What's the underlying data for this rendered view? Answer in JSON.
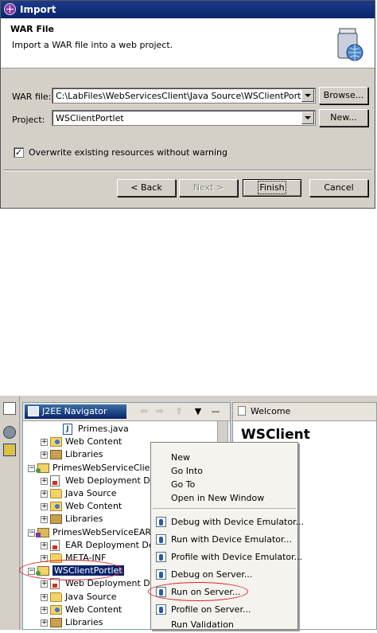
{
  "dialog": {
    "title": "Import",
    "banner_title": "WAR File",
    "banner_description": "Import a WAR file into a web project.",
    "war_file_label": "WAR file:",
    "war_file_value": "C:\\LabFiles\\WebServicesClient\\Java Source\\WSClientPortlet.wa",
    "browse_label": "Browse...",
    "project_label": "Project:",
    "project_value": "WSClientPortlet",
    "new_label": "New...",
    "overwrite_label": "Overwrite existing resources without warning",
    "overwrite_checked": true,
    "back_label": "< Back",
    "next_label": "Next >",
    "finish_label": "Finish",
    "cancel_label": "Cancel"
  },
  "navigator": {
    "tab_title": "J2EE Navigator",
    "welcome_tab": "Welcome",
    "welcome_heading": "WSClient",
    "tree": [
      {
        "label": "Primes.java",
        "icon": "java-file-icon",
        "indent": 3
      },
      {
        "label": "Web Content",
        "icon": "web-content-folder-icon",
        "indent": 2
      },
      {
        "label": "Libraries",
        "icon": "libraries-icon",
        "indent": 2
      },
      {
        "label": "PrimesWebServiceClient",
        "icon": "web-project-icon",
        "indent": 1
      },
      {
        "label": "Web Deployment De",
        "icon": "deployment-descriptor-icon",
        "indent": 2
      },
      {
        "label": "Java Source",
        "icon": "folder-icon",
        "indent": 2
      },
      {
        "label": "Web Content",
        "icon": "web-content-folder-icon",
        "indent": 2
      },
      {
        "label": "Libraries",
        "icon": "libraries-icon",
        "indent": 2
      },
      {
        "label": "PrimesWebServiceEAR",
        "icon": "ear-project-icon",
        "indent": 1
      },
      {
        "label": "EAR Deployment Des",
        "icon": "deployment-descriptor-icon",
        "indent": 2
      },
      {
        "label": "META-INF",
        "icon": "folder-icon",
        "indent": 2
      },
      {
        "label": "WSClientPortlet",
        "icon": "web-project-icon",
        "indent": 1,
        "selected": true
      },
      {
        "label": "Web Deployment De",
        "icon": "deployment-descriptor-icon",
        "indent": 2
      },
      {
        "label": "Java Source",
        "icon": "folder-icon",
        "indent": 2
      },
      {
        "label": "Web Content",
        "icon": "web-content-folder-icon",
        "indent": 2
      },
      {
        "label": "Libraries",
        "icon": "libraries-icon",
        "indent": 2
      }
    ]
  },
  "context_menu": {
    "items": [
      {
        "label": "New"
      },
      {
        "label": "Go Into"
      },
      {
        "label": "Go To"
      },
      {
        "label": "Open in New Window"
      },
      {
        "label": "Debug with Device Emulator..."
      },
      {
        "label": "Run with Device Emulator..."
      },
      {
        "label": "Profile with Device Emulator..."
      },
      {
        "label": "Debug on Server..."
      },
      {
        "label": "Run on Server..."
      },
      {
        "label": "Profile on Server..."
      },
      {
        "label": "Run Validation"
      }
    ]
  },
  "colors": {
    "titlebar": "#0a246a",
    "highlight_ellipse": "#e02020",
    "selection": "#0a246a"
  }
}
